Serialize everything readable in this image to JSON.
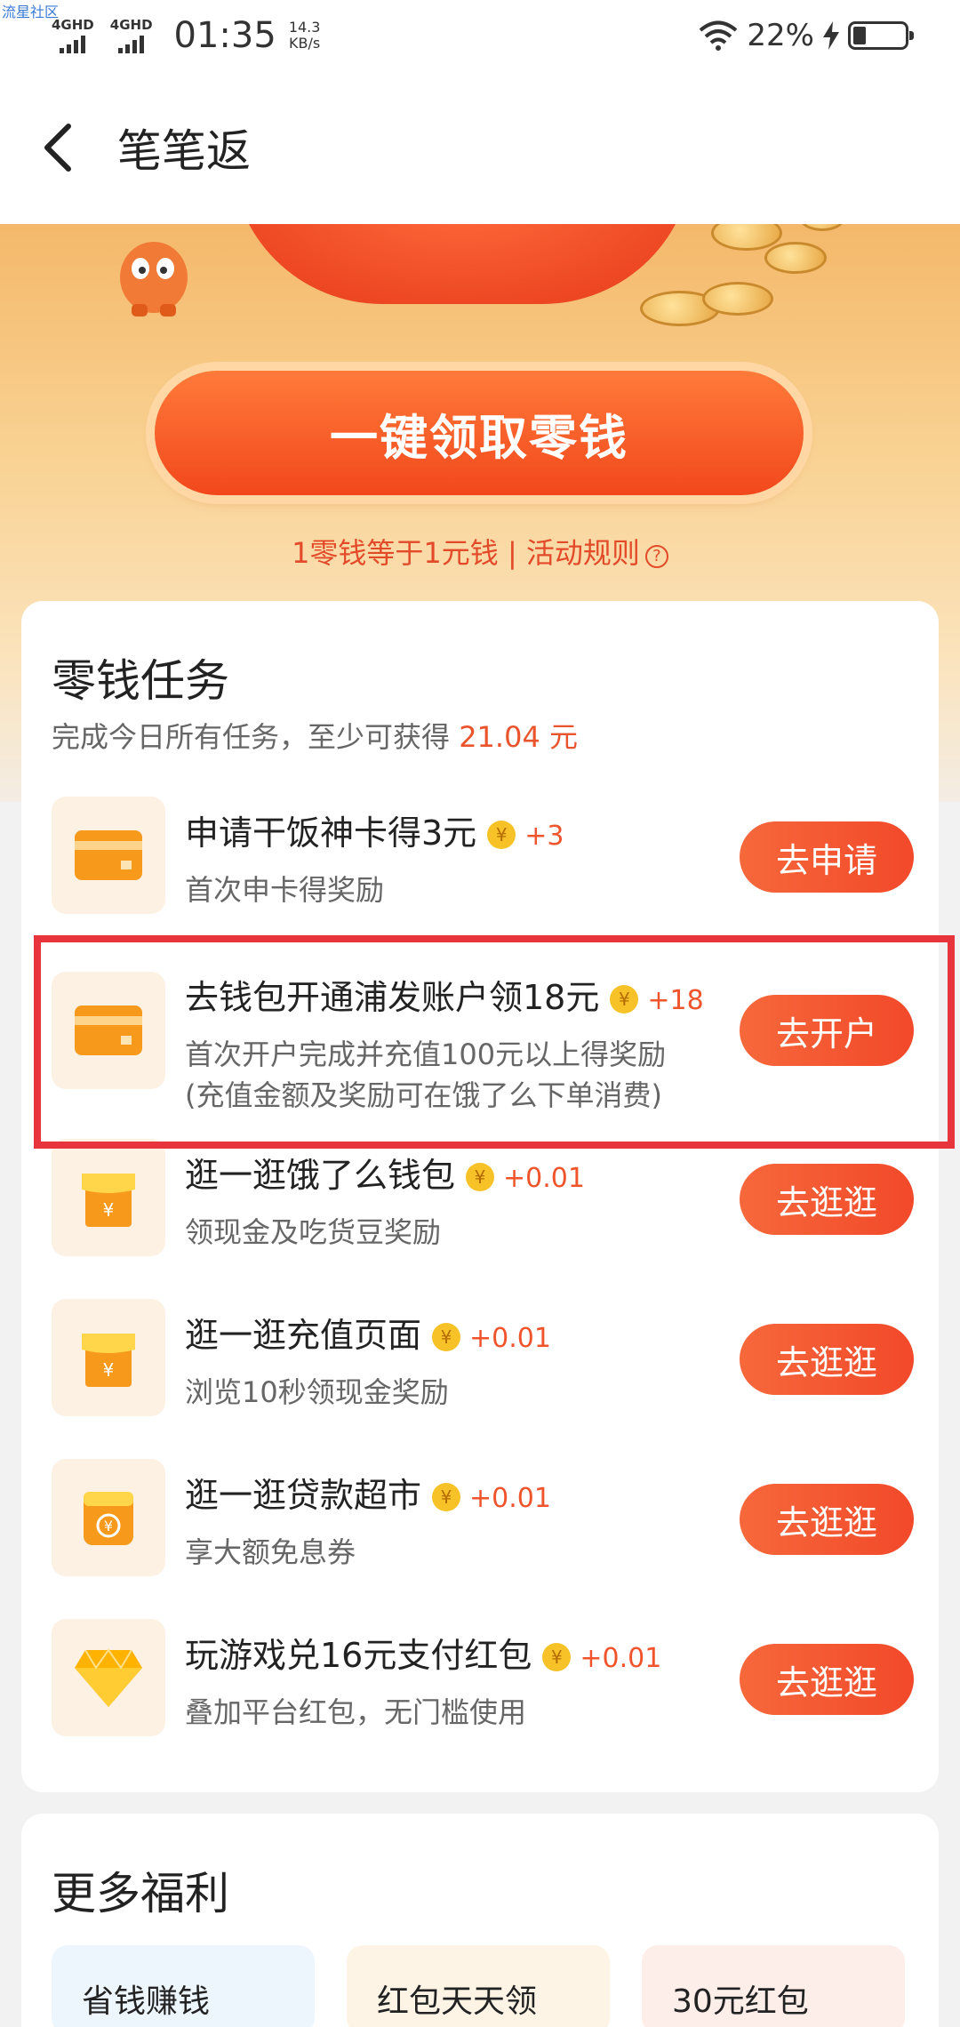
{
  "watermark": "流星社区",
  "status_bar": {
    "net1": "4GHD",
    "net2": "4GHD",
    "time": "01:35",
    "speed_value": "14.3",
    "speed_unit": "KB/s",
    "battery": "22%"
  },
  "header": {
    "title": "笔笔返"
  },
  "banner": {
    "claim_button": "一键领取零钱",
    "rule_text": "1零钱等于1元钱 | 活动规则"
  },
  "tasks": {
    "title": "零钱任务",
    "subtitle_prefix": "完成今日所有任务，至少可获得 ",
    "subtitle_amount": "21.04 元",
    "items": [
      {
        "name": "申请干饭神卡得3元",
        "reward": "+3",
        "desc1": "首次申卡得奖励",
        "desc2": "",
        "button": "去申请",
        "icon": "card-icon"
      },
      {
        "name": "去钱包开通浦发账户领18元",
        "reward": "+18",
        "desc1": "首次开户完成并充值100元以上得奖励",
        "desc2": "(充值金额及奖励可在饿了么下单消费)",
        "button": "去开户",
        "icon": "card-icon"
      },
      {
        "name": "逛一逛饿了么钱包",
        "reward": "+0.01",
        "desc1": "领现金及吃货豆奖励",
        "desc2": "",
        "button": "去逛逛",
        "icon": "shop-icon"
      },
      {
        "name": "逛一逛充值页面",
        "reward": "+0.01",
        "desc1": "浏览10秒领现金奖励",
        "desc2": "",
        "button": "去逛逛",
        "icon": "shop-icon"
      },
      {
        "name": "逛一逛贷款超市",
        "reward": "+0.01",
        "desc1": "享大额免息券",
        "desc2": "",
        "button": "去逛逛",
        "icon": "wallet-icon"
      },
      {
        "name": "玩游戏兑16元支付红包",
        "reward": "+0.01",
        "desc1": "叠加平台红包，无门槛使用",
        "desc2": "",
        "button": "去逛逛",
        "icon": "diamond-icon"
      }
    ]
  },
  "more": {
    "title": "更多福利",
    "items": [
      "省钱赚钱",
      "红包天天领",
      "30元红包"
    ]
  },
  "colors": {
    "accent": "#f2492a",
    "highlight": "#e8343c",
    "reward": "#f0542c"
  }
}
